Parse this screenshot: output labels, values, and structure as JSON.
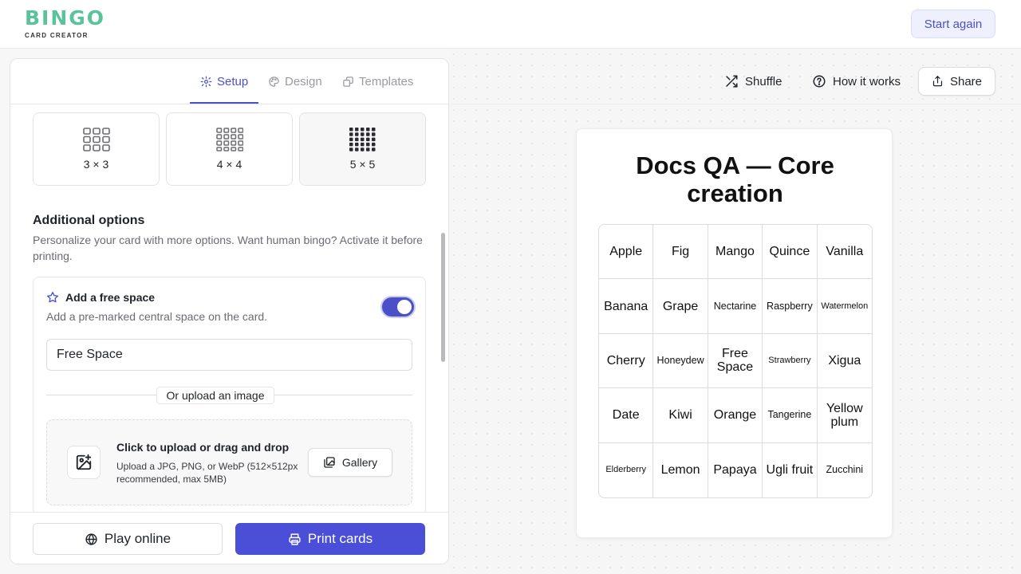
{
  "brand": {
    "logo_text": "BINGO",
    "logo_subtext": "CARD CREATOR",
    "colors": {
      "logo": "#5bc39a",
      "accent": "#4b50c9",
      "primary_button": "#4b4fd8"
    }
  },
  "header": {
    "start_again_label": "Start again"
  },
  "panel": {
    "tabs": [
      {
        "label": "Setup",
        "icon": "gear-icon",
        "active": true
      },
      {
        "label": "Design",
        "icon": "palette-icon",
        "active": false
      },
      {
        "label": "Templates",
        "icon": "templates-icon",
        "active": false
      }
    ],
    "grid_sizes": [
      {
        "label": "3 × 3",
        "n": 3,
        "selected": false
      },
      {
        "label": "4 × 4",
        "n": 4,
        "selected": false
      },
      {
        "label": "5 × 5",
        "n": 5,
        "selected": true
      }
    ],
    "additional_options": {
      "title": "Additional options",
      "description": "Personalize your card with more options. Want human bingo? Activate it before printing."
    },
    "free_space": {
      "title": "Add a free space",
      "description": "Add a pre-marked central space on the card.",
      "enabled": true,
      "value": "Free Space",
      "divider_label": "Or upload an image",
      "upload_title": "Click to upload or drag and drop",
      "upload_hint": "Upload a JPG, PNG, or WebP (512×512px recommended, max 5MB)",
      "gallery_label": "Gallery"
    },
    "footer": {
      "play_online_label": "Play online",
      "print_label": "Print cards"
    }
  },
  "toolbar": {
    "shuffle_label": "Shuffle",
    "how_it_works_label": "How it works",
    "share_label": "Share"
  },
  "card": {
    "title": "Docs QA — Core creation",
    "cells": [
      [
        "Apple",
        "Fig",
        "Mango",
        "Quince",
        "Vanilla"
      ],
      [
        "Banana",
        "Grape",
        "Nectarine",
        "Raspberry",
        "Watermelon"
      ],
      [
        "Cherry",
        "Honeydew",
        "Free Space",
        "Strawberry",
        "Xigua"
      ],
      [
        "Date",
        "Kiwi",
        "Orange",
        "Tangerine",
        "Yellow plum"
      ],
      [
        "Elderberry",
        "Lemon",
        "Papaya",
        "Ugli fruit",
        "Zucchini"
      ]
    ]
  }
}
